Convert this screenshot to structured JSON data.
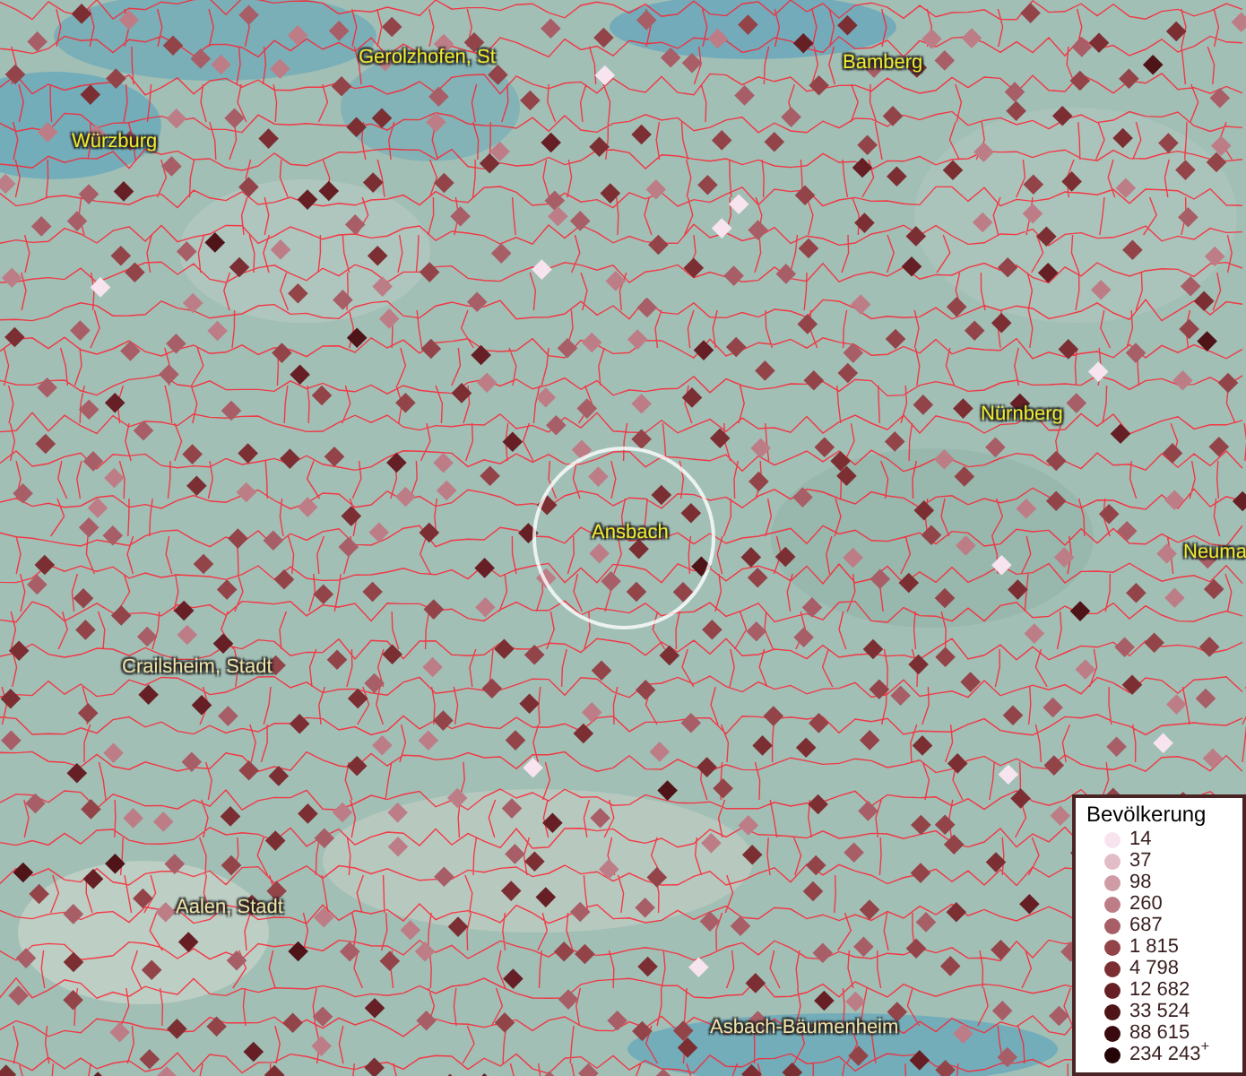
{
  "map": {
    "places": [
      {
        "name": "Gerolzhofen, St"
      },
      {
        "name": "Würzburg"
      },
      {
        "name": "Bamberg"
      },
      {
        "name": "Nürnberg"
      },
      {
        "name": "Ansbach",
        "selected": true
      },
      {
        "name": "Neuma"
      },
      {
        "name": "Crailsheim, Stadt"
      },
      {
        "name": "Aalen, Stadt"
      },
      {
        "name": "Asbach-Bäumenheim"
      }
    ]
  },
  "legend": {
    "title": "Bevölkerung",
    "items": [
      {
        "label": "14",
        "color": "#f7e4ee"
      },
      {
        "label": "37",
        "color": "#e2bcc6"
      },
      {
        "label": "98",
        "color": "#cf9ca6"
      },
      {
        "label": "260",
        "color": "#bd7d86"
      },
      {
        "label": "687",
        "color": "#a85e66"
      },
      {
        "label": "1 815",
        "color": "#934449"
      },
      {
        "label": "4 798",
        "color": "#7c2f33"
      },
      {
        "label": "12 682",
        "color": "#662025"
      },
      {
        "label": "33 524",
        "color": "#4f1418"
      },
      {
        "label": "88 615",
        "color": "#3a0b0e"
      },
      {
        "label": "234 243$^{+}$",
        "color": "#240406"
      }
    ]
  }
}
